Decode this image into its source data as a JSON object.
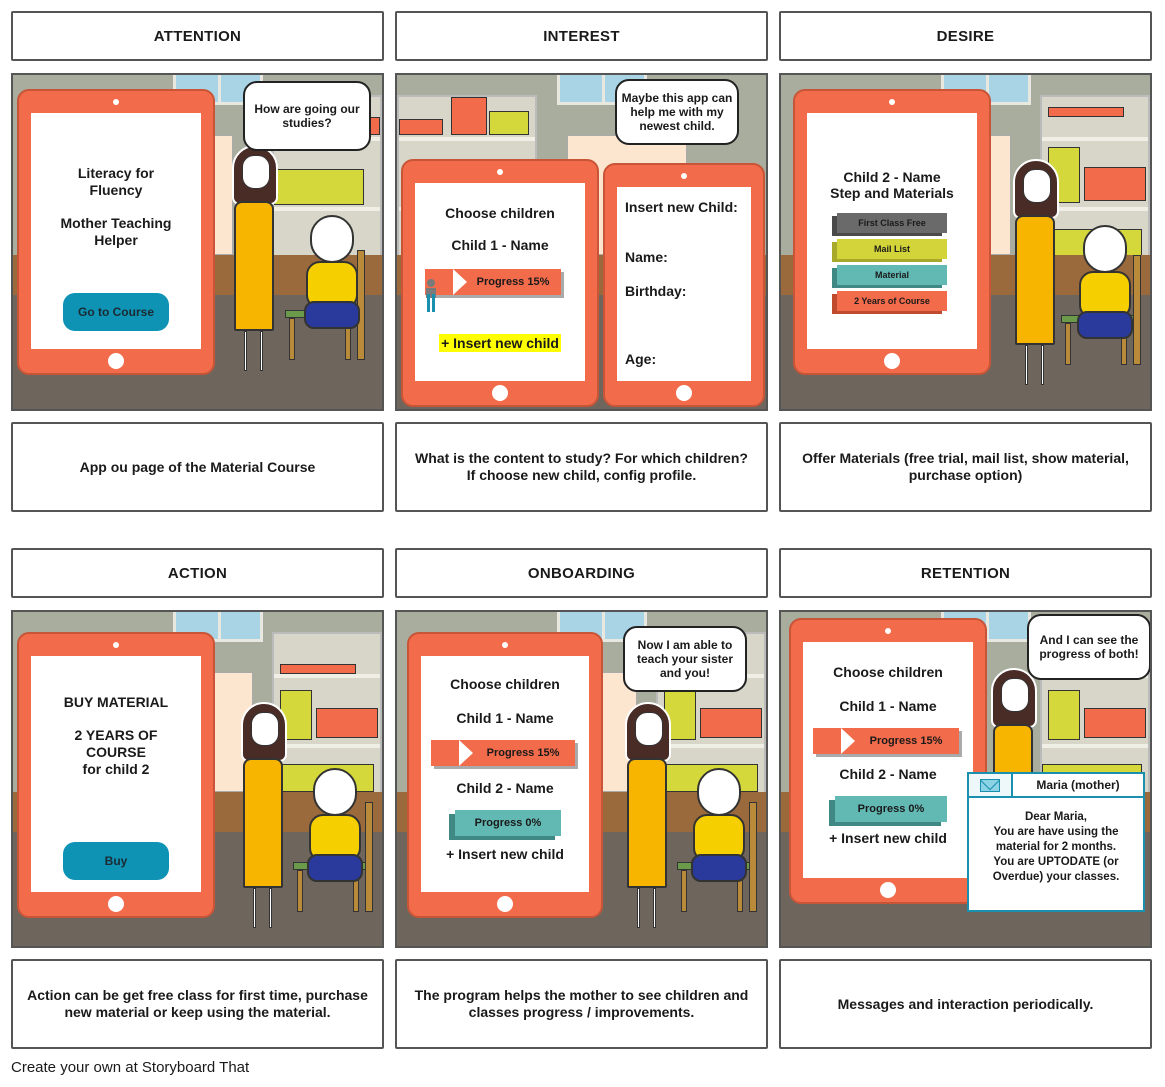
{
  "storyboard": {
    "headers": [
      "ATTENTION",
      "INTEREST",
      "DESIRE",
      "ACTION",
      "ONBOARDING",
      "RETENTION"
    ],
    "captions": [
      "App ou page of the Material Course",
      "What is the content to study? For which children? If choose new child, config profile.",
      "Offer Materials (free trial, mail list, show material, purchase option)",
      "Action can be get free class for first time, purchase new material or keep using the material.",
      "The program helps the mother to see children and classes progress / improvements.",
      "Messages and interaction periodically."
    ],
    "footer": "Create your own at Storyboard That"
  },
  "attention": {
    "title_line1": "Literacy for",
    "title_line2": "Fluency",
    "subtitle_line1": "Mother Teaching",
    "subtitle_line2": "Helper",
    "button": "Go to Course",
    "speech": "How are going our studies?"
  },
  "interest": {
    "left_title": "Choose children",
    "child1": "Child 1 - Name",
    "progress1": "Progress 15%",
    "progress1_value": 15,
    "insert": "+ Insert new child",
    "right_title": "Insert new Child:",
    "field_name": "Name:",
    "field_birthday": "Birthday:",
    "field_age": "Age:",
    "speech": "Maybe this app can help me with my newest child."
  },
  "desire": {
    "title": "Child 2 - Name",
    "subtitle": "Step and Materials",
    "options": [
      "First Class Free",
      "Mail List",
      "Material",
      "2 Years of Course"
    ]
  },
  "action": {
    "line1": "BUY MATERIAL",
    "line2": "2 YEARS OF",
    "line3": "COURSE",
    "line4": "for child 2",
    "button": "Buy"
  },
  "onboarding": {
    "title": "Choose children",
    "child1": "Child 1 - Name",
    "progress1": "Progress 15%",
    "progress1_value": 15,
    "child2": "Child 2 - Name",
    "progress2": "Progress 0%",
    "progress2_value": 0,
    "insert": "+ Insert new child",
    "speech": "Now I am able to teach your sister and you!"
  },
  "retention": {
    "title": "Choose children",
    "child1": "Child 1 - Name",
    "progress1": "Progress 15%",
    "progress1_value": 15,
    "child2": "Child 2 - Name",
    "progress2": "Progress 0%",
    "progress2_value": 0,
    "insert": "+ Insert new child",
    "speech": "And I can see the progress of both!",
    "mail_from": "Maria (mother)",
    "mail_line1": "Dear Maria,",
    "mail_line2": "You are have using the material for 2 months.",
    "mail_line3": "You are UPTODATE (or Overdue) your classes."
  },
  "colors": {
    "tablet": "#f26b4a",
    "button_teal": "#0e93b4",
    "progress_teal": "#62b8b3",
    "highlight_yellow": "#ffff00",
    "dress": "#f7b500"
  }
}
